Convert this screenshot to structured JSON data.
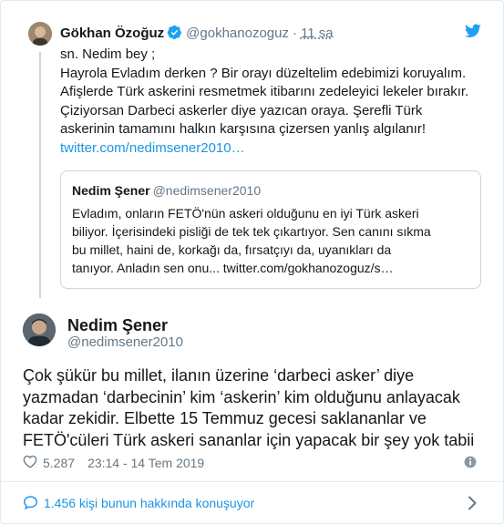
{
  "parent_tweet": {
    "author_name": "Gökhan Özoğuz",
    "author_handle": "@gokhanozoguz",
    "separator": "·",
    "time": "11 sa",
    "text_lines": [
      "sn. Nedim bey ;",
      "Hayrola Evladım derken ? Bir orayı düzeltelim edebimizi koruyalım.",
      "Afişlerde Türk askerini resmetmek itibarını zedeleyici lekeler bırakır.",
      "Çiziyorsan Darbeci askerler diye yazıcan oraya. Şerefli Türk",
      "askerinin tamamını halkın karşısına çizersen yanlış algılanır!"
    ],
    "link": "twitter.com/nedimsener2010…",
    "quoted": {
      "author_name": "Nedim Şener",
      "author_handle": "@nedimsener2010",
      "text_lines": [
        "Evladım, onların FETÖ'nün askeri olduğunu en iyi Türk askeri",
        "biliyor. İçerisindeki pisliği de tek tek çıkartıyor. Sen canını sıkma",
        "bu millet, haini de, korkağı da, fırsatçıyı da, uyanıkları da",
        "tanıyor. Anladın sen onu... twitter.com/gokhanozoguz/s…"
      ]
    }
  },
  "main_tweet": {
    "author_name": "Nedim Şener",
    "author_handle": "@nedimsener2010",
    "text_lines": [
      "Çok şükür bu millet, ilanın üzerine ‘darbeci asker’ diye",
      "yazmadan ‘darbecinin’ kim ‘askerin’ kim olduğunu anlayacak",
      "kadar zekidir. Elbette 15 Temmuz gecesi saklananlar ve",
      "FETÖ'cüleri Türk askeri sananlar için yapacak bir şey yok tabii"
    ],
    "likes": "5.287",
    "timestamp": "23:14 - 14 Tem 2019"
  },
  "footer": {
    "text": "1.456 kişi bunun hakkında konuşuyor"
  },
  "icons": {
    "verified": "verified-badge-icon",
    "twitter": "twitter-bird-icon",
    "heart": "heart-icon",
    "info": "info-icon",
    "comment": "speech-bubble-icon",
    "chevron": "chevron-right-icon"
  },
  "colors": {
    "link": "#1b95e0",
    "secondary_text": "#657786",
    "border": "#e1e8ed"
  }
}
